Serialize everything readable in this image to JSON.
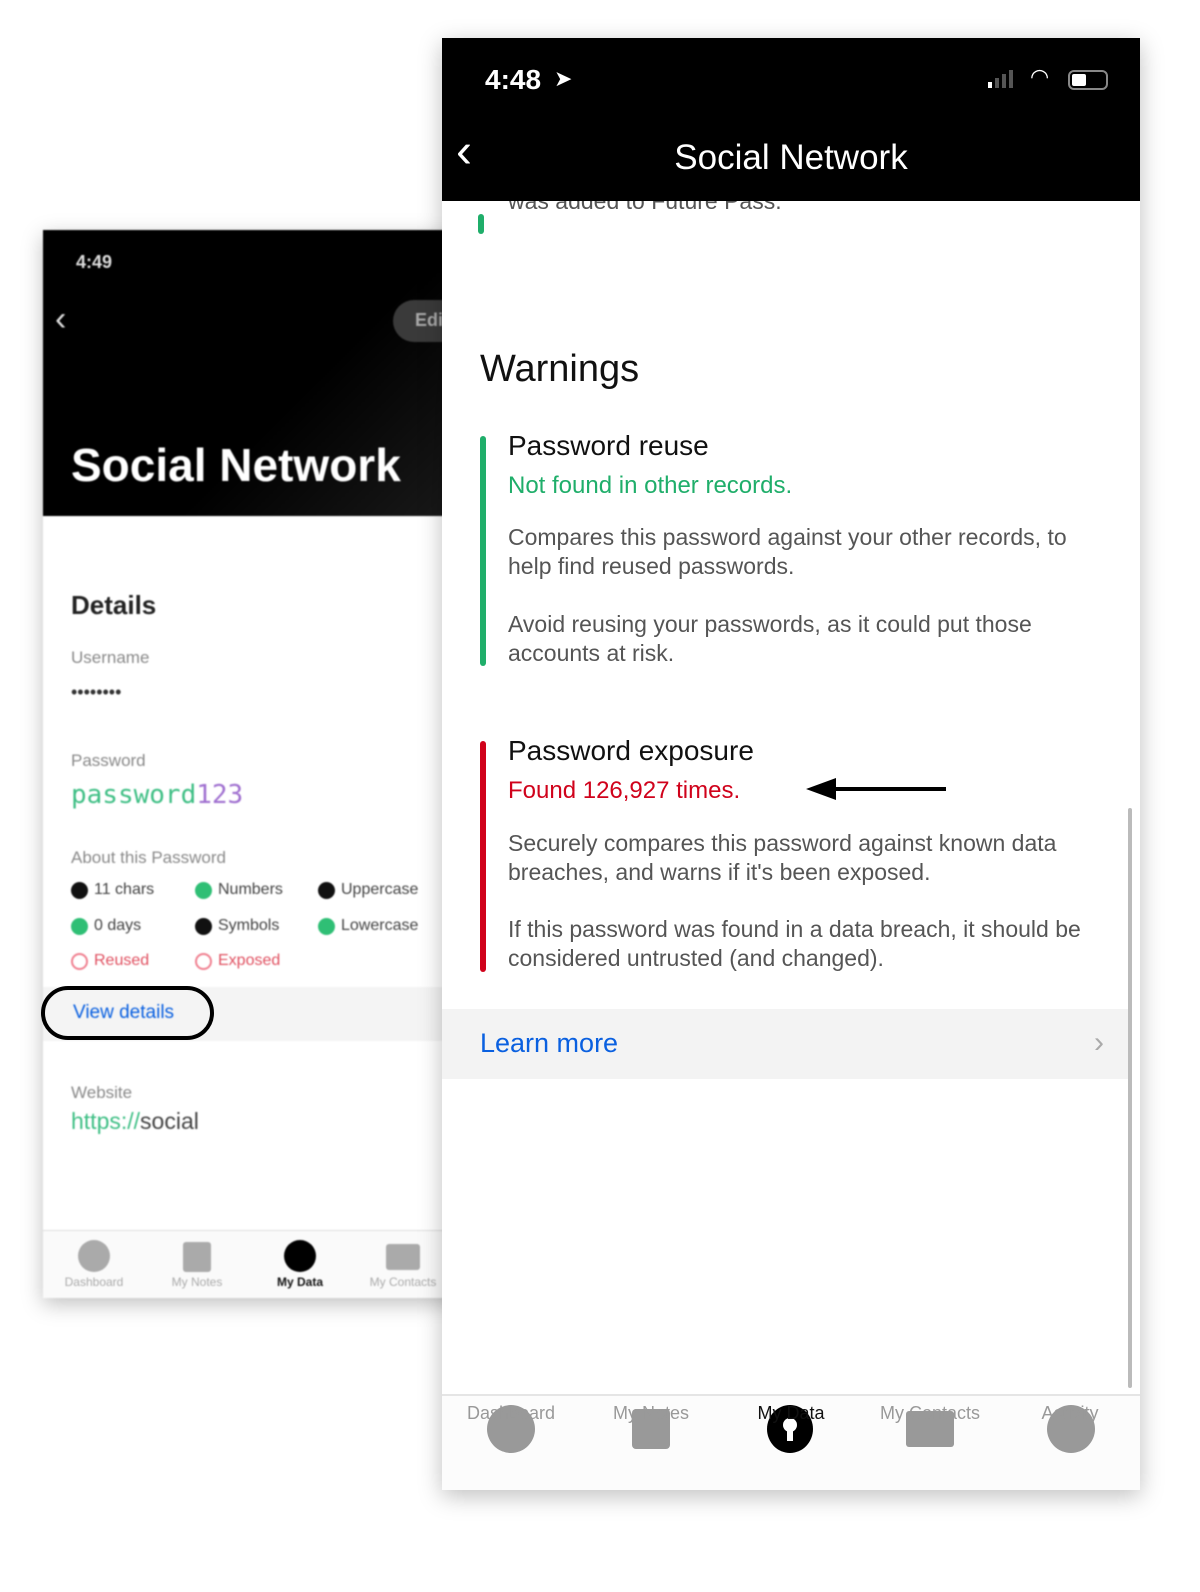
{
  "back_screen": {
    "time": "4:49",
    "edit_label": "Edit",
    "title": "Social Network",
    "section": "Details",
    "username_label": "Username",
    "username_value": "••••••••",
    "password_label": "Password",
    "password_letters": "password",
    "password_digits": "123",
    "about_label": "About this Password",
    "chips": [
      {
        "label": "11 chars",
        "status": "fail"
      },
      {
        "label": "Numbers",
        "status": "pass"
      },
      {
        "label": "Uppercase",
        "status": "fail"
      },
      {
        "label": "0 days",
        "status": "pass"
      },
      {
        "label": "Symbols",
        "status": "fail"
      },
      {
        "label": "Lowercase",
        "status": "pass"
      },
      {
        "label": "Reused",
        "status": "warn"
      },
      {
        "label": "Exposed",
        "status": "warn"
      }
    ],
    "view_details": "View details",
    "website_label": "Website",
    "website_scheme": "https://",
    "website_host": "social",
    "tabs": [
      "Dashboard",
      "My Notes",
      "My Data",
      "My Contacts"
    ]
  },
  "front_screen": {
    "time": "4:48",
    "title": "Social Network",
    "scrolled_text": "was added to Future Pass.",
    "section": "Warnings",
    "warnings": [
      {
        "title": "Password reuse",
        "status": "Not found in other records.",
        "p1": "Compares this password against your other records, to help find reused passwords.",
        "p2": "Avoid reusing your passwords, as it could put those accounts at risk.",
        "color": "#1fae6a"
      },
      {
        "title": "Password exposure",
        "status": "Found 126,927 times.",
        "p1": "Securely compares this password against known data breaches, and warns if it's been exposed.",
        "p2": "If this password was found in a data breach, it should be considered untrusted (and changed).",
        "color": "#d0021b"
      }
    ],
    "learn_more": "Learn more",
    "tabs": [
      {
        "label": "Dashboard",
        "icon": "person-icon",
        "active": false
      },
      {
        "label": "My Notes",
        "icon": "notes-icon",
        "active": false
      },
      {
        "label": "My Data",
        "icon": "keyhole-icon",
        "active": true
      },
      {
        "label": "My Contacts",
        "icon": "contact-card-icon",
        "active": false
      },
      {
        "label": "Activity",
        "icon": "bell-icon",
        "active": false
      }
    ]
  },
  "colors": {
    "accent_blue": "#0a60e0",
    "green": "#1fae6a",
    "red": "#d0021b",
    "purple": "#9b59c6"
  }
}
